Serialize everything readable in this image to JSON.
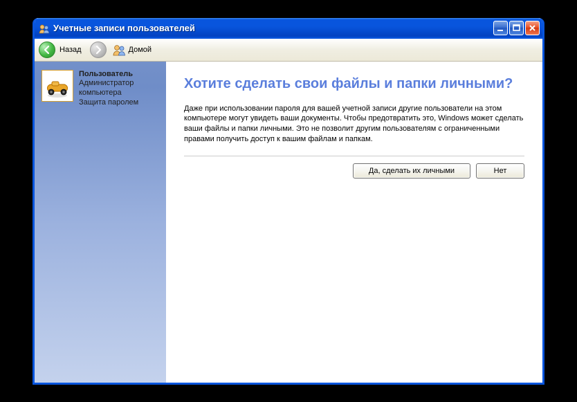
{
  "window": {
    "title": "Учетные записи пользователей"
  },
  "toolbar": {
    "back_label": "Назад",
    "home_label": "Домой"
  },
  "sidebar": {
    "user": {
      "name": "Пользователь",
      "role_line1": "Администратор",
      "role_line2": "компьютера",
      "protection": "Защита паролем"
    }
  },
  "main": {
    "heading": "Хотите сделать свои файлы и папки личными?",
    "body": "Даже при использовании пароля для вашей учетной записи другие пользователи на этом компьютере могут увидеть ваши документы. Чтобы предотвратить это, Windows может сделать ваши файлы и папки личными. Это не позволит другим пользователям с ограниченными правами получить доступ к вашим файлам и папкам.",
    "btn_yes": "Да, сделать их личными",
    "btn_no": "Нет"
  }
}
